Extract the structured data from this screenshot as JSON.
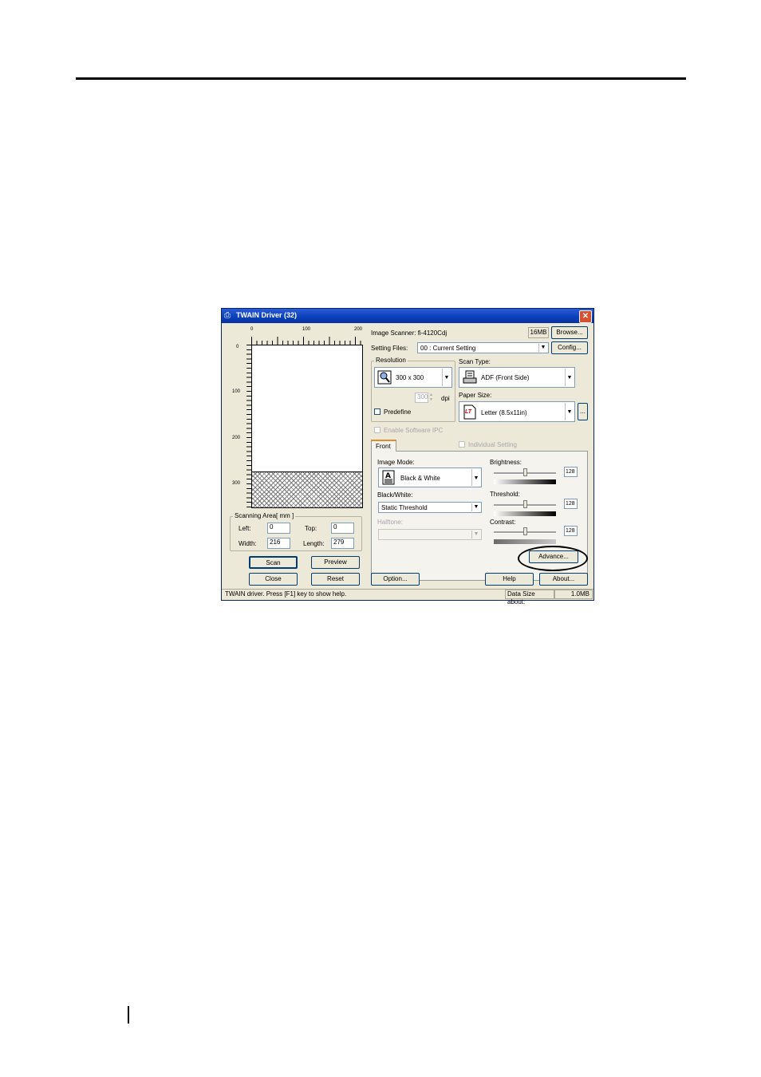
{
  "window": {
    "title": "TWAIN Driver (32)"
  },
  "ruler": {
    "top_ticks": [
      "0",
      "100",
      "200"
    ],
    "left_ticks": [
      "0",
      "100",
      "200",
      "300"
    ]
  },
  "scanning_area": {
    "label": "Scanning Area[ mm ]",
    "left_label": "Left:",
    "left_value": "0",
    "top_label": "Top:",
    "top_value": "0",
    "width_label": "Width:",
    "width_value": "216",
    "length_label": "Length:",
    "length_value": "279"
  },
  "left_buttons": {
    "scan": "Scan",
    "preview": "Preview",
    "close": "Close",
    "reset": "Reset"
  },
  "scanner": {
    "label": "Image Scanner: fi-4120Cdj",
    "memory": "16MB",
    "browse": "Browse..."
  },
  "setting_files": {
    "label": "Setting Files:",
    "value": "00 : Current Setting",
    "config": "Config..."
  },
  "resolution": {
    "label": "Resolution",
    "value": "300 x 300",
    "custom_value": "300",
    "unit": "dpi",
    "predefine": "Predefine"
  },
  "scan_type": {
    "label": "Scan Type:",
    "value": "ADF (Front Side)"
  },
  "paper_size": {
    "label": "Paper Size:",
    "value": "Letter (8.5x11in)",
    "more": "...",
    "icon_text": "LT"
  },
  "enable_ipc": "Enable Software IPC",
  "front_tab": {
    "label": "Front",
    "individual": "Individual Setting"
  },
  "image_mode": {
    "label": "Image Mode:",
    "value": "Black & White"
  },
  "black_white": {
    "label": "Black/White:",
    "value": "Static Threshold"
  },
  "halftone": {
    "label": "Halftone:"
  },
  "brightness": {
    "label": "Brightness:",
    "value": "128",
    "level": 0.5
  },
  "threshold": {
    "label": "Threshold:",
    "value": "128",
    "level": 0.5
  },
  "contrast": {
    "label": "Contrast:",
    "value": "128",
    "level": 0.5
  },
  "advance_button": "Advance...",
  "bottom_buttons": {
    "option": "Option...",
    "help": "Help",
    "about": "About..."
  },
  "status_bar": {
    "message": "TWAIN driver. Press [F1] key to show help.",
    "data_size_label": "Data Size about:",
    "data_size_value": "1.0MB"
  }
}
